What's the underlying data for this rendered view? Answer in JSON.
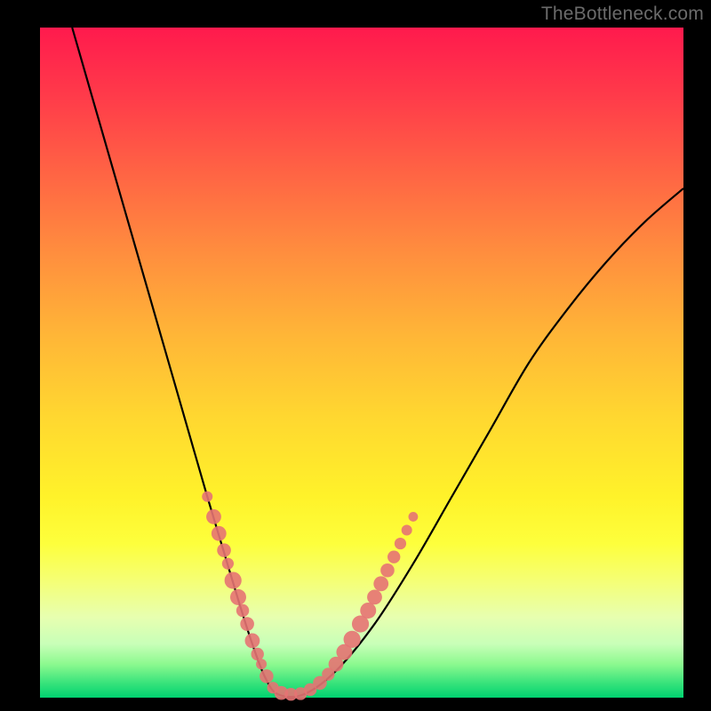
{
  "watermark": "TheBottleneck.com",
  "chart_data": {
    "type": "line",
    "title": "",
    "xlabel": "",
    "ylabel": "",
    "xlim": [
      0,
      100
    ],
    "ylim": [
      0,
      100
    ],
    "series": [
      {
        "name": "bottleneck-curve",
        "x": [
          5,
          8,
          11,
          14,
          17,
          20,
          23,
          26,
          28.5,
          31,
          33,
          35,
          37,
          41,
          46,
          52,
          58,
          64,
          70,
          76,
          82,
          88,
          94,
          100
        ],
        "y": [
          100,
          90,
          80,
          70,
          60,
          50,
          40,
          30,
          22,
          14,
          8,
          3,
          0.5,
          0.5,
          4,
          11,
          20,
          30,
          40,
          50,
          58,
          65,
          71,
          76
        ]
      }
    ],
    "markers": {
      "name": "highlight-dots",
      "color": "#e57373",
      "points": [
        {
          "x": 26.0,
          "y": 30.0,
          "r": 1.0
        },
        {
          "x": 27.0,
          "y": 27.0,
          "r": 1.4
        },
        {
          "x": 27.8,
          "y": 24.5,
          "r": 1.4
        },
        {
          "x": 28.6,
          "y": 22.0,
          "r": 1.3
        },
        {
          "x": 29.2,
          "y": 20.0,
          "r": 1.1
        },
        {
          "x": 30.0,
          "y": 17.5,
          "r": 1.6
        },
        {
          "x": 30.8,
          "y": 15.0,
          "r": 1.5
        },
        {
          "x": 31.5,
          "y": 13.0,
          "r": 1.2
        },
        {
          "x": 32.2,
          "y": 11.0,
          "r": 1.3
        },
        {
          "x": 33.0,
          "y": 8.5,
          "r": 1.4
        },
        {
          "x": 33.8,
          "y": 6.5,
          "r": 1.2
        },
        {
          "x": 34.4,
          "y": 5.0,
          "r": 1.0
        },
        {
          "x": 35.2,
          "y": 3.2,
          "r": 1.3
        },
        {
          "x": 36.2,
          "y": 1.5,
          "r": 1.1
        },
        {
          "x": 37.5,
          "y": 0.7,
          "r": 1.3
        },
        {
          "x": 39.0,
          "y": 0.5,
          "r": 1.2
        },
        {
          "x": 40.5,
          "y": 0.6,
          "r": 1.2
        },
        {
          "x": 42.0,
          "y": 1.2,
          "r": 1.2
        },
        {
          "x": 43.5,
          "y": 2.2,
          "r": 1.3
        },
        {
          "x": 44.8,
          "y": 3.5,
          "r": 1.2
        },
        {
          "x": 46.0,
          "y": 5.0,
          "r": 1.4
        },
        {
          "x": 47.3,
          "y": 6.8,
          "r": 1.5
        },
        {
          "x": 48.5,
          "y": 8.7,
          "r": 1.6
        },
        {
          "x": 49.8,
          "y": 11.0,
          "r": 1.6
        },
        {
          "x": 51.0,
          "y": 13.0,
          "r": 1.5
        },
        {
          "x": 52.0,
          "y": 15.0,
          "r": 1.4
        },
        {
          "x": 53.0,
          "y": 17.0,
          "r": 1.4
        },
        {
          "x": 54.0,
          "y": 19.0,
          "r": 1.3
        },
        {
          "x": 55.0,
          "y": 21.0,
          "r": 1.2
        },
        {
          "x": 56.0,
          "y": 23.0,
          "r": 1.1
        },
        {
          "x": 57.0,
          "y": 25.0,
          "r": 1.0
        },
        {
          "x": 58.0,
          "y": 27.0,
          "r": 0.9
        }
      ]
    }
  }
}
